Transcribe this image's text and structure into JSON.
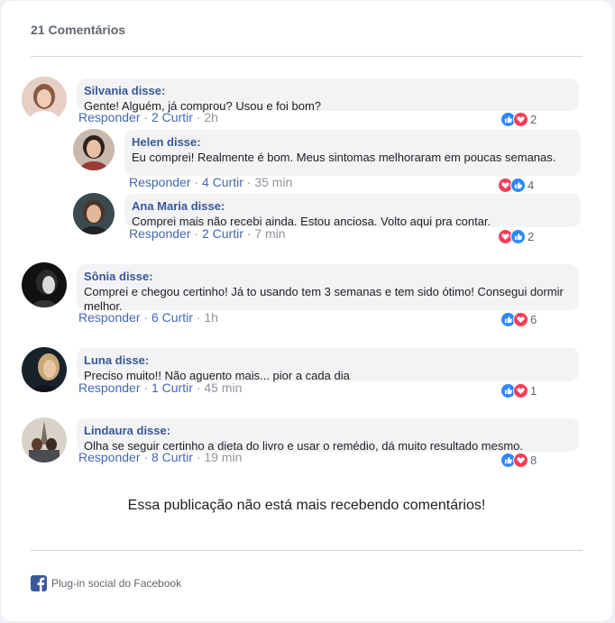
{
  "header": {
    "count_label": "21 Comentários"
  },
  "actions": {
    "reply": "Responder",
    "like": "Curtir",
    "sep": " · "
  },
  "comments": [
    {
      "author": "Silvania disse:",
      "text": "Gente! Alguém, já comprou? Usou e foi bom?",
      "likes": "2",
      "time": "2h",
      "reaction_count": "2",
      "reactions": [
        "like",
        "love"
      ]
    },
    {
      "author": "Helen disse:",
      "text": "Eu comprei! Realmente é bom. Meus sintomas melhoraram em poucas semanas.",
      "likes": "4",
      "time": "35 min",
      "reaction_count": "4",
      "reactions": [
        "love",
        "like"
      ]
    },
    {
      "author": "Ana Maria disse:",
      "text": "Comprei mais não recebi ainda. Estou anciosa. Volto aqui pra contar.",
      "likes": "2",
      "time": "7 min",
      "reaction_count": "2",
      "reactions": [
        "love",
        "like"
      ]
    },
    {
      "author": "Sônia disse:",
      "text": "Comprei e chegou certinho! Já to usando tem 3 semanas e tem sido ótimo! Consegui dormir melhor.",
      "likes": "6",
      "time": "1h",
      "reaction_count": "6",
      "reactions": [
        "like",
        "love"
      ]
    },
    {
      "author": "Luna disse:",
      "text": "Preciso muito!! Não aguento mais... pior a cada dia",
      "likes": "1",
      "time": "45 min",
      "reaction_count": "1",
      "reactions": [
        "like",
        "love"
      ]
    },
    {
      "author": "Lindaura disse:",
      "text": "Olha se seguir certinho a dieta do livro e usar o remédio, dá muito resultado mesmo.",
      "likes": "8",
      "time": "19 min",
      "reaction_count": "8",
      "reactions": [
        "like",
        "love"
      ]
    }
  ],
  "closed_message": "Essa publicação não está mais recebendo comentários!",
  "footer": {
    "plugin_label": "Plug-in social do Facebook",
    "icon": "facebook-icon"
  },
  "colors": {
    "link": "#4267b2",
    "author": "#385898",
    "like": "#2d88ff",
    "love": "#f33e58",
    "bubble": "#f2f3f5"
  }
}
